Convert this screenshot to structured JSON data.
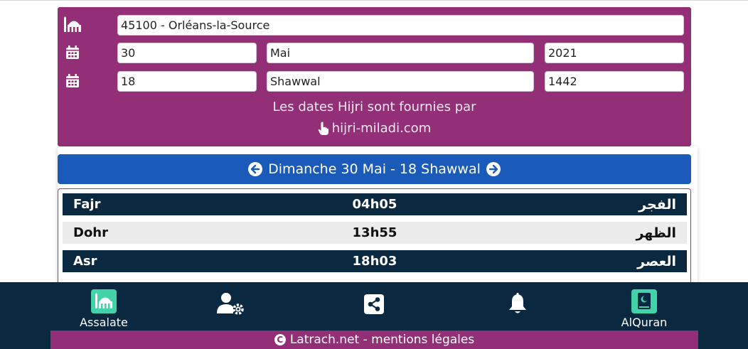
{
  "location": {
    "value": "45100 - Orléans-la-Source"
  },
  "gregorian": {
    "day": "30",
    "month": "Mai",
    "year": "2021"
  },
  "hijri": {
    "day": "18",
    "month": "Shawwal",
    "year": "1442"
  },
  "credit": {
    "text": "Les dates Hijri sont fournies par",
    "link": "hijri-miladi.com"
  },
  "date_nav": {
    "label": "Dimanche 30 Mai - 18 Shawwal"
  },
  "prayers": [
    {
      "name": "Fajr",
      "time": "04h05",
      "arabic": "الفجر"
    },
    {
      "name": "Dohr",
      "time": "13h55",
      "arabic": "الظهر"
    },
    {
      "name": "Asr",
      "time": "18h03",
      "arabic": "العصر"
    }
  ],
  "bottom_nav": {
    "assalate": "Assalate",
    "alquran": "AlQuran"
  },
  "footer": {
    "text": "Latrach.net - mentions légales"
  },
  "colors": {
    "purple": "#922f76",
    "blue": "#1a5ab8",
    "navy": "#0b2841",
    "mint": "#42d3a8"
  }
}
